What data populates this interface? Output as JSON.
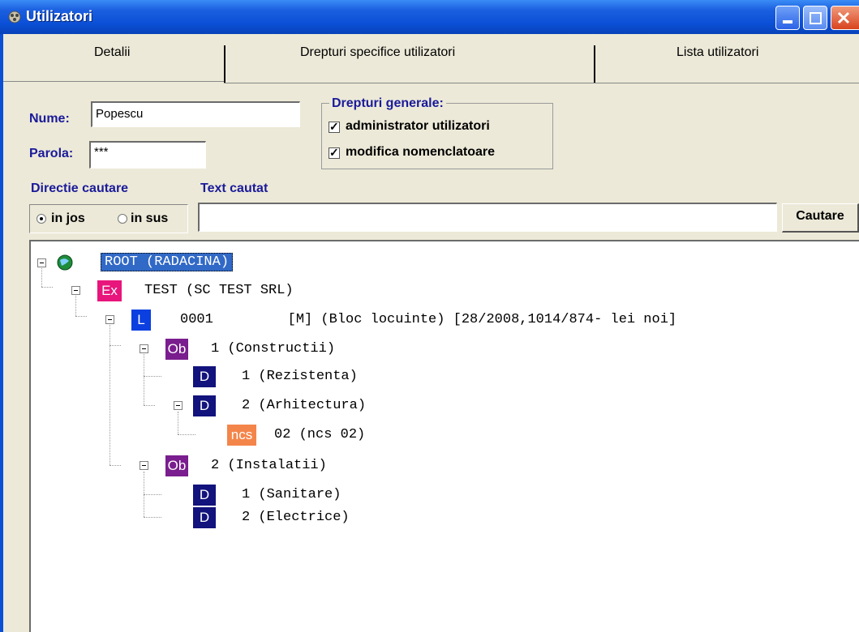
{
  "window": {
    "title": "Utilizatori"
  },
  "tabs": [
    {
      "label": "Detalii"
    },
    {
      "label": "Drepturi specifice utilizatori"
    },
    {
      "label": "Lista utilizatori"
    }
  ],
  "form": {
    "nume_label": "Nume:",
    "nume_value": "Popescu",
    "parola_label": "Parola:",
    "parola_value": "***",
    "drepturi_title": "Drepturi generale:",
    "admin_label": "administrator utilizatori",
    "modifica_label": "modifica nomenclatoare",
    "check_mark": "✓"
  },
  "search": {
    "directie_label": "Directie cautare",
    "text_label": "Text cautat",
    "in_jos": "in jos",
    "in_sus": "in sus",
    "text_value": "",
    "button": "Cautare"
  },
  "tree": {
    "root": "ROOT (RADACINA)",
    "nodes": [
      {
        "badge": "Ex",
        "color": "#e8157c",
        "text": "TEST (SC TEST SRL)"
      },
      {
        "badge": "L",
        "color": "#0b3fe0",
        "text": "0001         [M] (Bloc locuinte) [28/2008,1014/874- lei noi]"
      },
      {
        "badge": "Ob",
        "color": "#7a1d8e",
        "text": "1 (Constructii)"
      },
      {
        "badge": "D",
        "color": "#12137c",
        "text": "1 (Rezistenta)"
      },
      {
        "badge": "D",
        "color": "#12137c",
        "text": "2 (Arhitectura)"
      },
      {
        "badge": "ncs",
        "color": "#f4854a",
        "text": "02 (ncs 02)"
      },
      {
        "badge": "Ob",
        "color": "#7a1d8e",
        "text": "2 (Instalatii)"
      },
      {
        "badge": "D",
        "color": "#12137c",
        "text": "1 (Sanitare)"
      },
      {
        "badge": "D",
        "color": "#12137c",
        "text": "2 (Electrice)"
      }
    ]
  }
}
